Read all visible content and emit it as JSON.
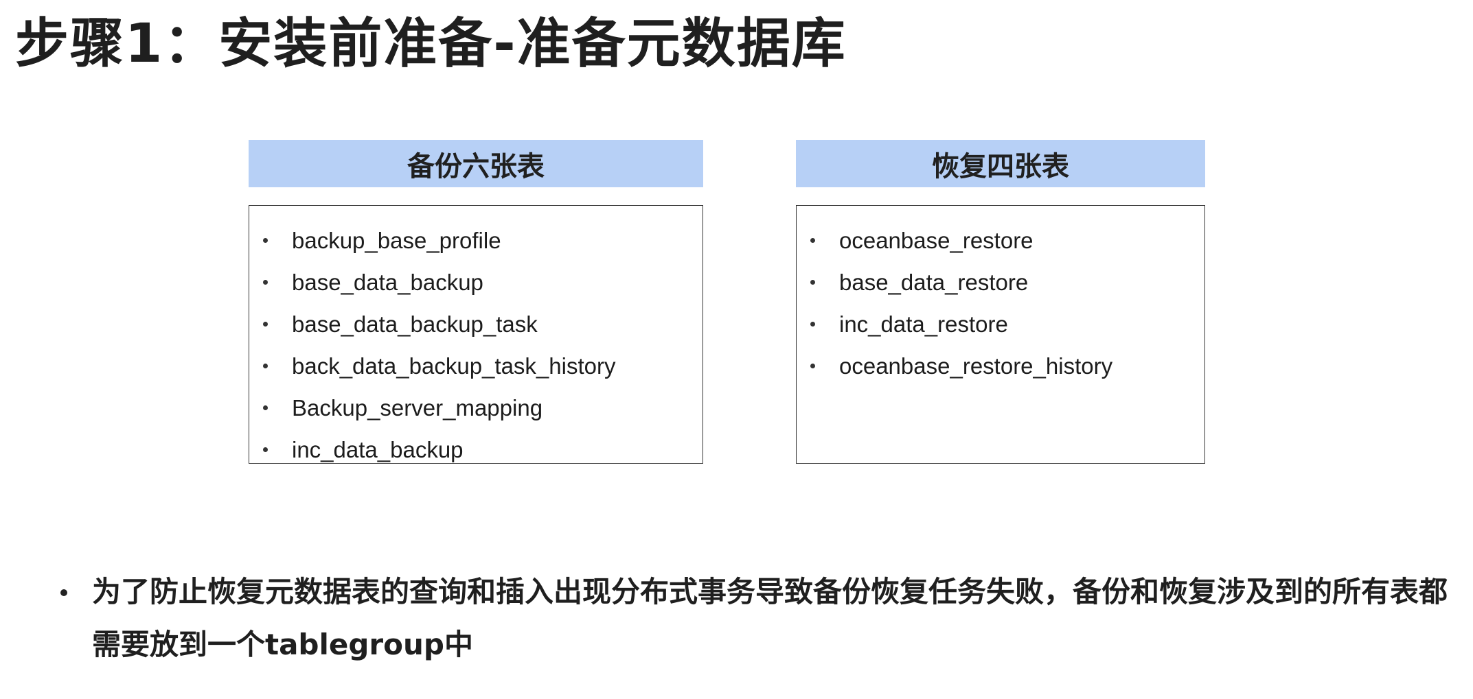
{
  "title": "步骤1：安装前准备-准备元数据库",
  "backup_panel": {
    "header": "备份六张表",
    "items": [
      "backup_base_profile",
      "base_data_backup",
      "base_data_backup_task",
      "back_data_backup_task_history",
      "Backup_server_mapping",
      "inc_data_backup"
    ]
  },
  "restore_panel": {
    "header": "恢复四张表",
    "items": [
      "oceanbase_restore",
      "base_data_restore",
      "inc_data_restore",
      "oceanbase_restore_history"
    ]
  },
  "note": "为了防止恢复元数据表的查询和插入出现分布式事务导致备份恢复任务失败，备份和恢复涉及到的所有表都需要放到一个tablegroup中",
  "colors": {
    "header_bg": "#b7d0f6",
    "text": "#1f1f1f",
    "border": "#333333"
  }
}
